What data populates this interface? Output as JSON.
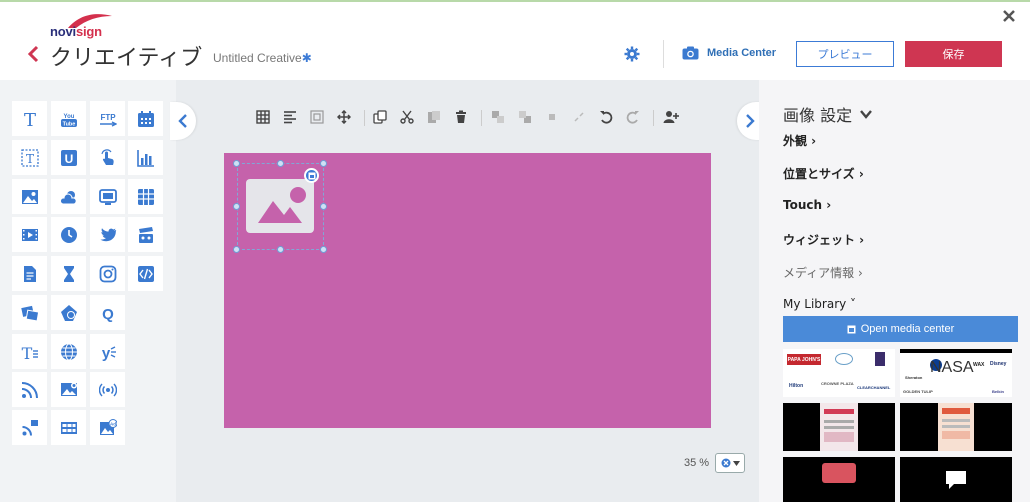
{
  "app": {
    "logo_text_a": "novi",
    "logo_text_b": "sign",
    "page_title": "クリエイティブ",
    "creative_name": "Untitled Creative",
    "creative_name_marker": "✱"
  },
  "header": {
    "media_center_label": "Media Center",
    "preview_label": "プレビュー",
    "save_label": "保存"
  },
  "toolbox": {
    "tools": [
      "text-icon",
      "youtube-icon",
      "ftp-icon",
      "calendar-icon",
      "text-box-icon",
      "u-widget-icon",
      "touch-icon",
      "bar-chart-icon",
      "image-icon",
      "weather-icon",
      "screen-icon",
      "table-icon",
      "video-icon",
      "clock-icon",
      "twitter-icon",
      "clapperboard-icon",
      "document-icon",
      "hourglass-icon",
      "instagram-icon",
      "html-code-icon",
      "slideshow-icon",
      "shapes-icon",
      "q-widget-icon",
      "",
      "scrolling-text-icon",
      "globe-icon",
      "yammer-icon",
      "",
      "rss-icon",
      "image-rss-icon",
      "broadcast-icon",
      "",
      "rss-feed-icon",
      "video-stream-icon",
      "image-ad-icon",
      ""
    ]
  },
  "canvas": {
    "zoom_label": "35 %",
    "artboard_color": "#c562ab"
  },
  "properties": {
    "title": "画像 設定",
    "items": [
      {
        "label": "外観 ›"
      },
      {
        "label": "位置とサイズ ›"
      },
      {
        "label": "Touch ›"
      },
      {
        "label": "ウィジェット ›"
      },
      {
        "label": "メディア情報 ›"
      },
      {
        "label": "My Library ˅"
      }
    ],
    "open_media_label": "Open media center",
    "library_logos": [
      "PAPA JOHN'S",
      "Hilton",
      "CROWNE PLAZA",
      "CLEARCHANNEL",
      "Sheraton",
      "NASA",
      "WAX",
      "GOLDEN TULIP",
      "Disney",
      "Belkin"
    ]
  },
  "colors": {
    "accent": "#3c7bd6",
    "save": "#cf3652",
    "artboard": "#c562ab",
    "icon": "#3b7ad0"
  }
}
